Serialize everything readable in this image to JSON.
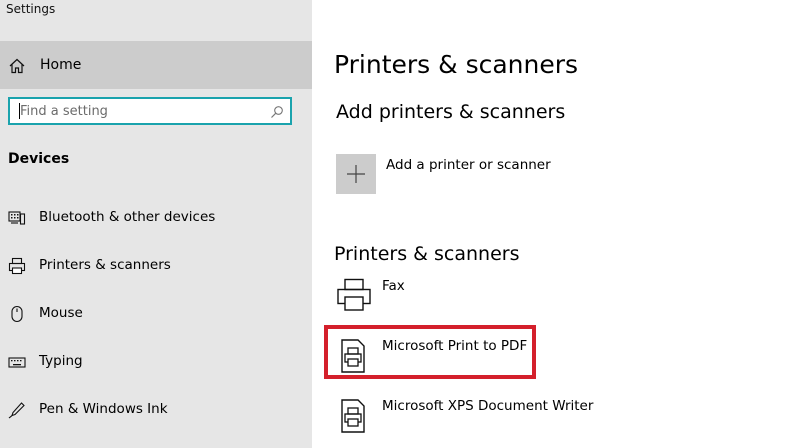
{
  "app": {
    "title": "Settings"
  },
  "sidebar": {
    "home_label": "Home",
    "search_placeholder": "Find a setting",
    "section_heading": "Devices",
    "items": [
      {
        "label": "Bluetooth & other devices",
        "icon": "bluetooth-devices-icon"
      },
      {
        "label": "Printers & scanners",
        "icon": "printer-icon"
      },
      {
        "label": "Mouse",
        "icon": "mouse-icon"
      },
      {
        "label": "Typing",
        "icon": "keyboard-icon"
      },
      {
        "label": "Pen & Windows Ink",
        "icon": "pen-icon"
      }
    ]
  },
  "main": {
    "page_title": "Printers & scanners",
    "add_heading": "Add printers & scanners",
    "add_label": "Add a printer or scanner",
    "list_heading": "Printers & scanners",
    "printers": [
      {
        "name": "Fax",
        "icon": "fax-printer-icon"
      },
      {
        "name": "Microsoft Print to PDF",
        "icon": "document-printer-icon"
      },
      {
        "name": "Microsoft XPS Document Writer",
        "icon": "document-printer-icon"
      }
    ]
  },
  "colors": {
    "sidebar_bg": "#e6e6e6",
    "selected_bg": "#cccccc",
    "search_border": "#1aa3ad",
    "highlight": "#d4202b"
  }
}
